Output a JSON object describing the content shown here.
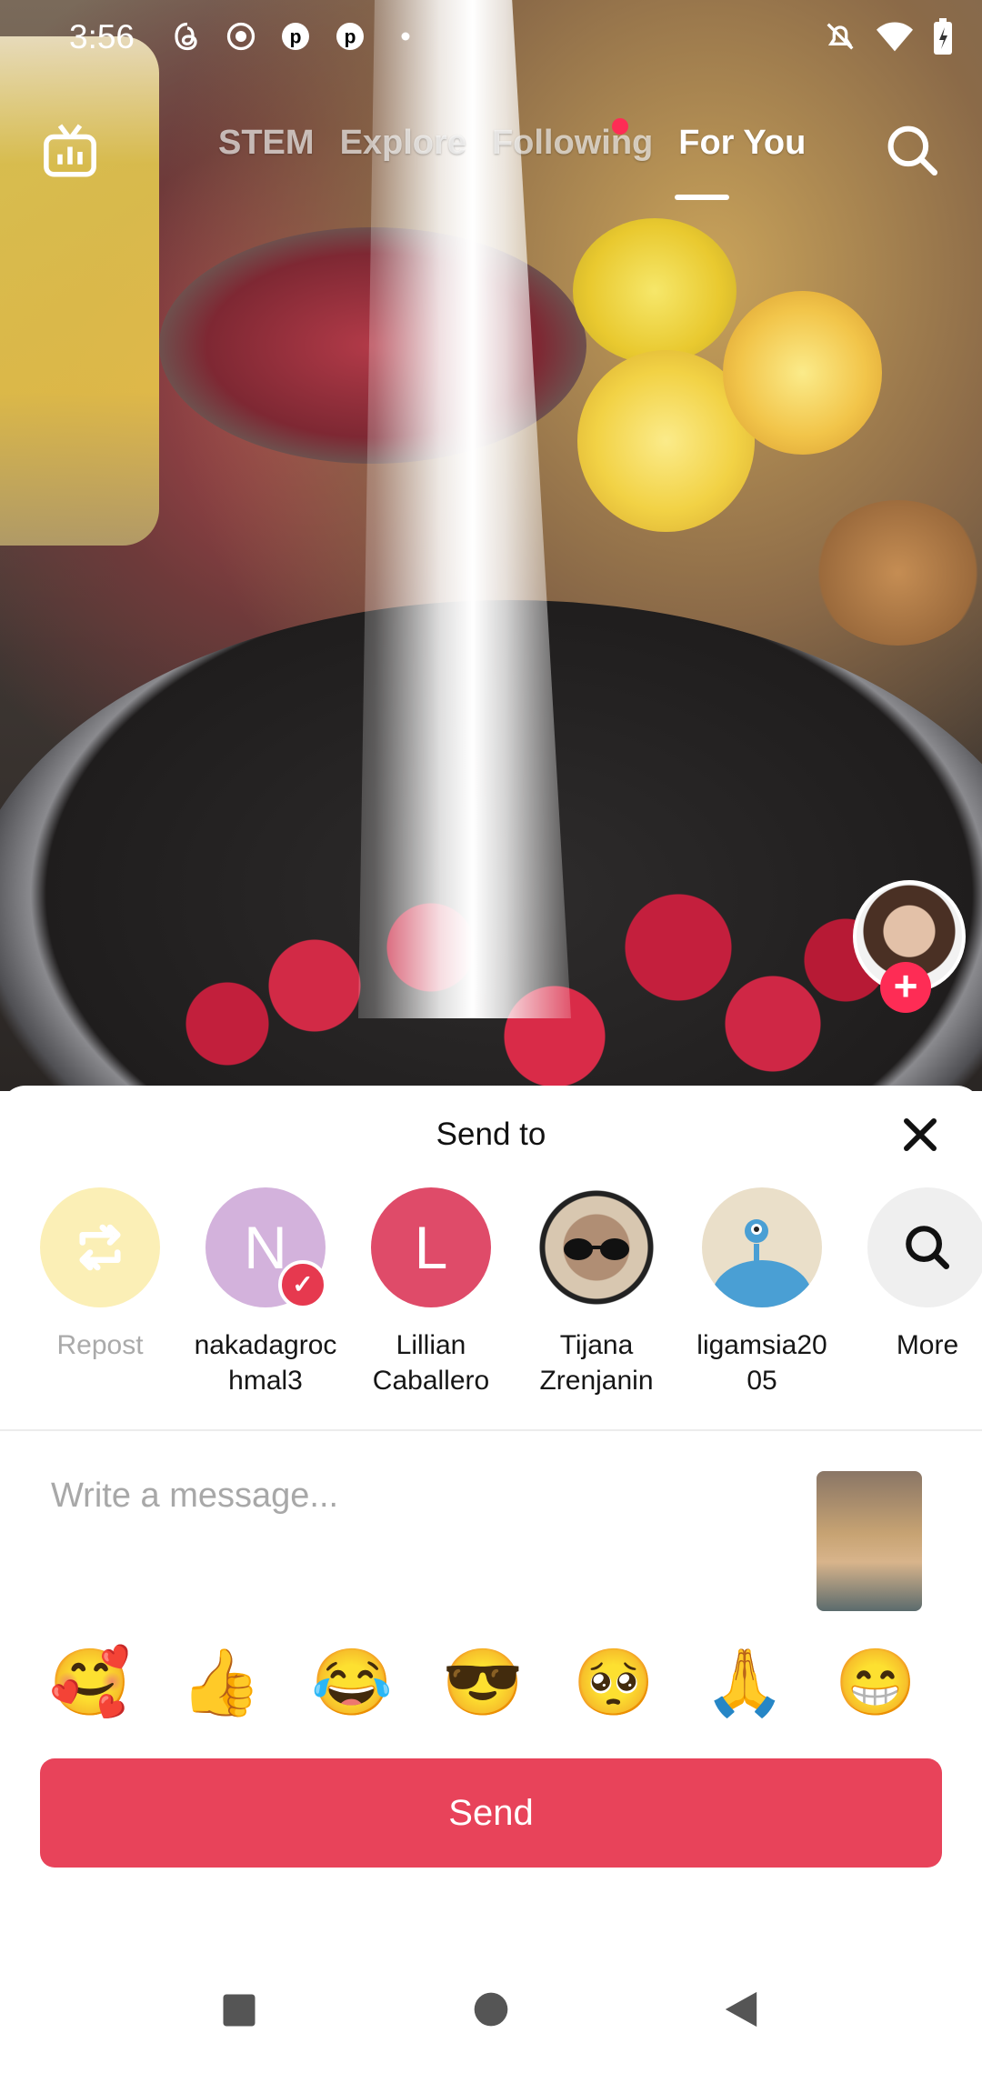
{
  "status_bar": {
    "time": "3:56",
    "notification_icons": [
      "threads-icon",
      "record-icon",
      "pinterest-icon",
      "pinterest-icon",
      "dot-icon"
    ],
    "right_icons": [
      "mute-icon",
      "wifi-icon",
      "battery-charging-icon"
    ]
  },
  "top_nav": {
    "tabs": [
      {
        "label": "STEM",
        "active": false
      },
      {
        "label": "Explore",
        "active": false
      },
      {
        "label": "Following",
        "active": false
      },
      {
        "label": "For You",
        "active": true
      }
    ],
    "has_live_dot": true
  },
  "share_sheet": {
    "title": "Send to",
    "recipients": [
      {
        "label": "Repost",
        "icon": "repost-icon",
        "color": "#fbefb6",
        "type": "action"
      },
      {
        "label": "nakadagroc\nhmal3",
        "initial": "N",
        "color": "#d3b2dc",
        "verified": true
      },
      {
        "label": "Lillian\nCaballero",
        "initial": "L",
        "color": "#df4b69"
      },
      {
        "label": "Tijana\nZrenjanin",
        "avatar": "cat-photo"
      },
      {
        "label": "ligamsia20\n05",
        "avatar": "blue-creature"
      },
      {
        "label": "More",
        "icon": "search-icon",
        "color": "#efefef"
      }
    ],
    "message_placeholder": "Write a message...",
    "emojis": [
      "🥰",
      "👍",
      "😂",
      "😎",
      "🥺",
      "🙏",
      "😁"
    ],
    "send_label": "Send"
  },
  "colors": {
    "accent": "#e8435a",
    "tiktok_red": "#fe2c55"
  }
}
